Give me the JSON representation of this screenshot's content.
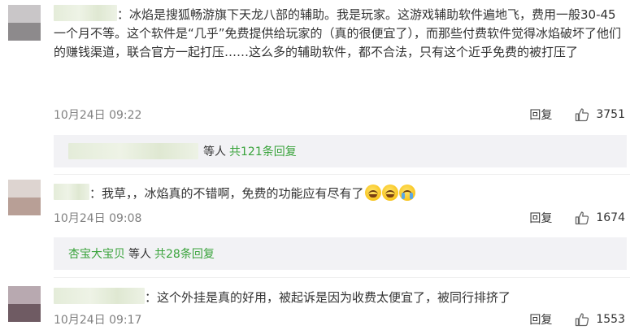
{
  "colors": {
    "link_green": "#39a33b",
    "meta_gray": "#808080",
    "reply_bg": "#f2f2f5"
  },
  "comments": [
    {
      "text": "：冰焰是搜狐畅游旗下天龙八部的辅助。我是玩家。这游戏辅助软件遍地飞，费用一般30-45一个月不等。这个软件是“几乎”免费提供给玩家的（真的很便宜了），而那些付费软件觉得冰焰破坏了他们的赚钱渠道，联合官方一起打压……这么多的辅助软件，都不合法，只有这个近乎免费的被打压了",
      "time": "10月24日 09:22",
      "reply_label": "回复",
      "likes": "3751",
      "replies": {
        "users_suffix": "等人",
        "count_text": "共121条回复"
      },
      "avatar_icon": "user-avatar"
    },
    {
      "text": "：我草，，冰焰真的不错啊，免费的功能应有尽有了",
      "emojis": [
        "laugh-cry-emoji",
        "laugh-cry-emoji",
        "cry-emoji"
      ],
      "time": "10月24日 09:08",
      "reply_label": "回复",
      "likes": "1674",
      "replies": {
        "user": "杏宝大宝贝",
        "users_suffix": "等人",
        "count_text": "共28条回复"
      },
      "avatar_icon": "user-avatar"
    },
    {
      "text": "：这个外挂是真的好用，被起诉是因为收费太便宜了，被同行排挤了",
      "time": "10月24日 09:17",
      "reply_label": "回复",
      "likes": "1553",
      "avatar_icon": "user-avatar"
    }
  ],
  "icons": {
    "like": "thumbs-up-icon"
  }
}
